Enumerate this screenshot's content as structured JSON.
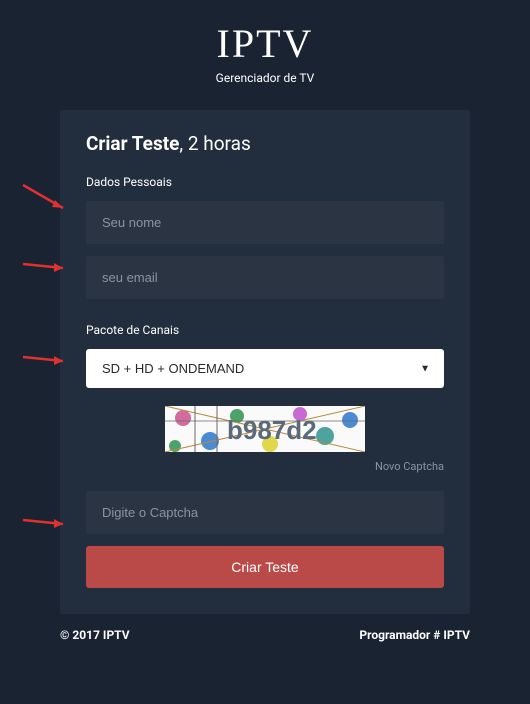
{
  "header": {
    "logo": "IPTV",
    "subtitle": "Gerenciador de TV"
  },
  "card": {
    "title_bold": "Criar Teste",
    "title_rest": ", 2 horas",
    "section_personal": "Dados Pessoais",
    "name_placeholder": "Seu nome",
    "email_placeholder": "seu email",
    "section_channels": "Pacote de Canais",
    "select_value": "SD + HD + ONDEMAND",
    "captcha_value": "b987d2",
    "new_captcha": "Novo Captcha",
    "captcha_placeholder": "Digite o Captcha",
    "submit": "Criar Teste"
  },
  "footer": {
    "copyright": "© 2017 IPTV",
    "developer": "Programador # IPTV"
  },
  "colors": {
    "bg": "#1a2332",
    "card_bg": "#222d3d",
    "input_bg": "#2a3442",
    "button": "#b94a48"
  }
}
